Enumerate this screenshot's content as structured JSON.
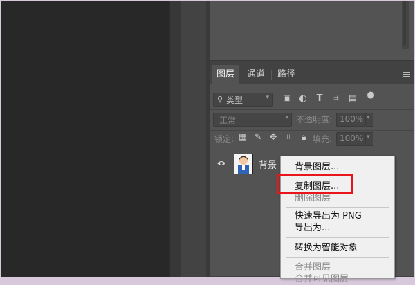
{
  "layers_panel": {
    "tabs": [
      {
        "label": "图层",
        "active": true
      },
      {
        "label": "通道",
        "active": false
      },
      {
        "label": "路径",
        "active": false
      }
    ],
    "filter": {
      "icon": "search-icon",
      "label": "类型"
    },
    "blend_mode": {
      "value": "正常"
    },
    "opacity": {
      "label": "不透明度:",
      "value": "100%"
    },
    "lock": {
      "label": "锁定:"
    },
    "fill": {
      "label": "填充:",
      "value": "100%"
    },
    "layer": {
      "name": "背景"
    }
  },
  "context_menu": {
    "items": [
      {
        "label": "背景图层...",
        "disabled": false
      },
      {
        "label": "复制图层...",
        "disabled": false
      },
      {
        "label": "删除图层",
        "disabled": true
      },
      {
        "label": "快速导出为 PNG",
        "disabled": false
      },
      {
        "label": "导出为...",
        "disabled": false
      },
      {
        "label": "转换为智能对象",
        "disabled": false
      },
      {
        "label": "合并图层",
        "disabled": true
      },
      {
        "label": "合并可见图层",
        "disabled": true
      }
    ]
  },
  "colors": {
    "highlight": "#e8161b",
    "panel": "#535353",
    "canvas": "#282828"
  }
}
